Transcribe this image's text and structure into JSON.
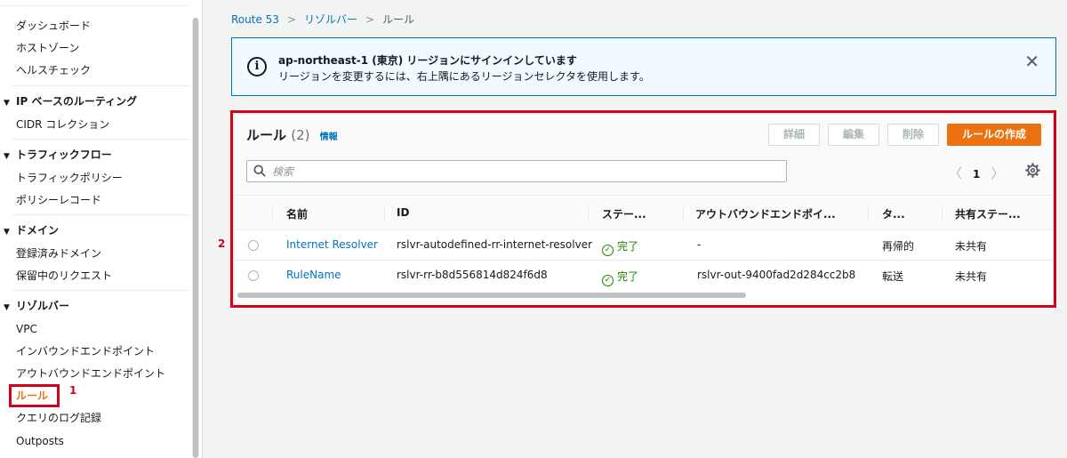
{
  "sidebar": {
    "items": [
      {
        "label": "ダッシュボード",
        "type": "link"
      },
      {
        "label": "ホストゾーン",
        "type": "link"
      },
      {
        "label": "ヘルスチェック",
        "type": "link"
      },
      {
        "label": "IP ベースのルーティング",
        "type": "section"
      },
      {
        "label": "CIDR コレクション",
        "type": "link"
      },
      {
        "label": "トラフィックフロー",
        "type": "section"
      },
      {
        "label": "トラフィックポリシー",
        "type": "link"
      },
      {
        "label": "ポリシーレコード",
        "type": "link"
      },
      {
        "label": "ドメイン",
        "type": "section"
      },
      {
        "label": "登録済みドメイン",
        "type": "link"
      },
      {
        "label": "保留中のリクエスト",
        "type": "link"
      },
      {
        "label": "リゾルバー",
        "type": "section"
      },
      {
        "label": "VPC",
        "type": "link"
      },
      {
        "label": "インバウンドエンドポイント",
        "type": "link"
      },
      {
        "label": "アウトバウンドエンドポイント",
        "type": "link"
      },
      {
        "label": "ルール",
        "type": "link",
        "active": true
      },
      {
        "label": "クエリのログ記録",
        "type": "link"
      },
      {
        "label": "Outposts",
        "type": "link"
      }
    ]
  },
  "annotations": {
    "marker1": "1",
    "marker2": "2"
  },
  "breadcrumb": {
    "items": [
      "Route 53",
      "リゾルバー",
      "ルール"
    ]
  },
  "flash": {
    "title": "ap-northeast-1 (東京) リージョンにサインインしています",
    "body": "リージョンを変更するには、右上隅にあるリージョンセレクタを使用します。",
    "icon": "info-icon",
    "close_icon": "close-icon"
  },
  "table": {
    "title": "ルール",
    "count": "(2)",
    "info_link": "情報",
    "buttons": {
      "details": "詳細",
      "edit": "編集",
      "delete": "削除",
      "create": "ルールの作成"
    },
    "search": {
      "placeholder": "検索"
    },
    "pagination": {
      "current_page": "1"
    },
    "columns": [
      "名前",
      "ID",
      "ステー...",
      "アウトバウンドエンドポイ...",
      "タ...",
      "共有ステー..."
    ],
    "rows": [
      {
        "name": "Internet Resolver",
        "id": "rslvr-autodefined-rr-internet-resolver",
        "status": "完了",
        "outbound": "-",
        "type": "再帰的",
        "sharing": "未共有"
      },
      {
        "name": "RuleName",
        "id": "rslvr-rr-b8d556814d824f6d8",
        "status": "完了",
        "outbound": "rslvr-out-9400fad2d284cc2b8",
        "type": "転送",
        "sharing": "未共有"
      }
    ]
  },
  "colors": {
    "accent": "#ec7211",
    "link": "#0073bb",
    "success": "#1d8102",
    "annotation": "#d0021b"
  }
}
